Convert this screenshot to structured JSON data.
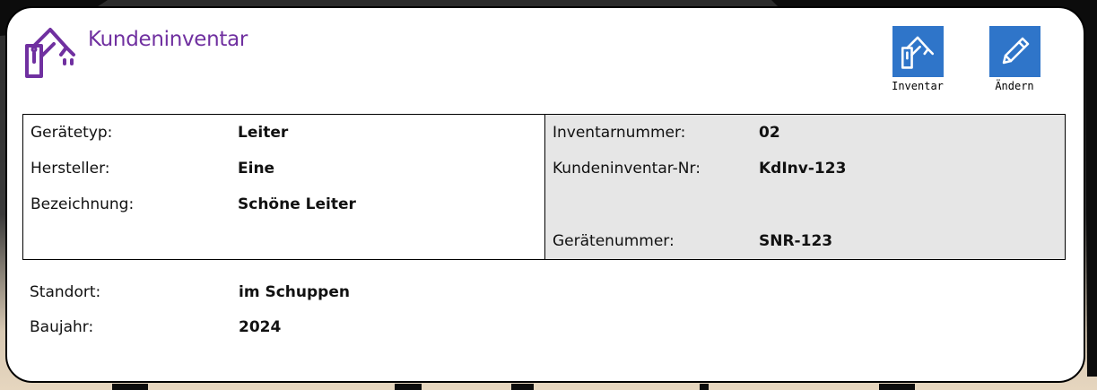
{
  "header": {
    "title": "Kundeninventar",
    "logo_icon": "robot-arm-icon",
    "accent_color": "#7030a0"
  },
  "actions": [
    {
      "label": "Inventar",
      "icon": "robot-arm-icon"
    },
    {
      "label": "Ändern",
      "icon": "pencil-icon"
    }
  ],
  "button_color": "#2f75c9",
  "details_left": [
    {
      "label": "Gerätetyp:",
      "value": "Leiter"
    },
    {
      "label": "Hersteller:",
      "value": "Eine"
    },
    {
      "label": "Bezeichnung:",
      "value": "Schöne Leiter"
    }
  ],
  "details_right": [
    {
      "label": "Inventarnummer:",
      "value": "02"
    },
    {
      "label": "Kundeninventar-Nr:",
      "value": "KdInv-123"
    },
    {
      "label": "Gerätenummer:",
      "value": "SNR-123"
    }
  ],
  "extra": [
    {
      "label": "Standort:",
      "value": "im Schuppen"
    },
    {
      "label": "Baujahr:",
      "value": "2024"
    }
  ]
}
